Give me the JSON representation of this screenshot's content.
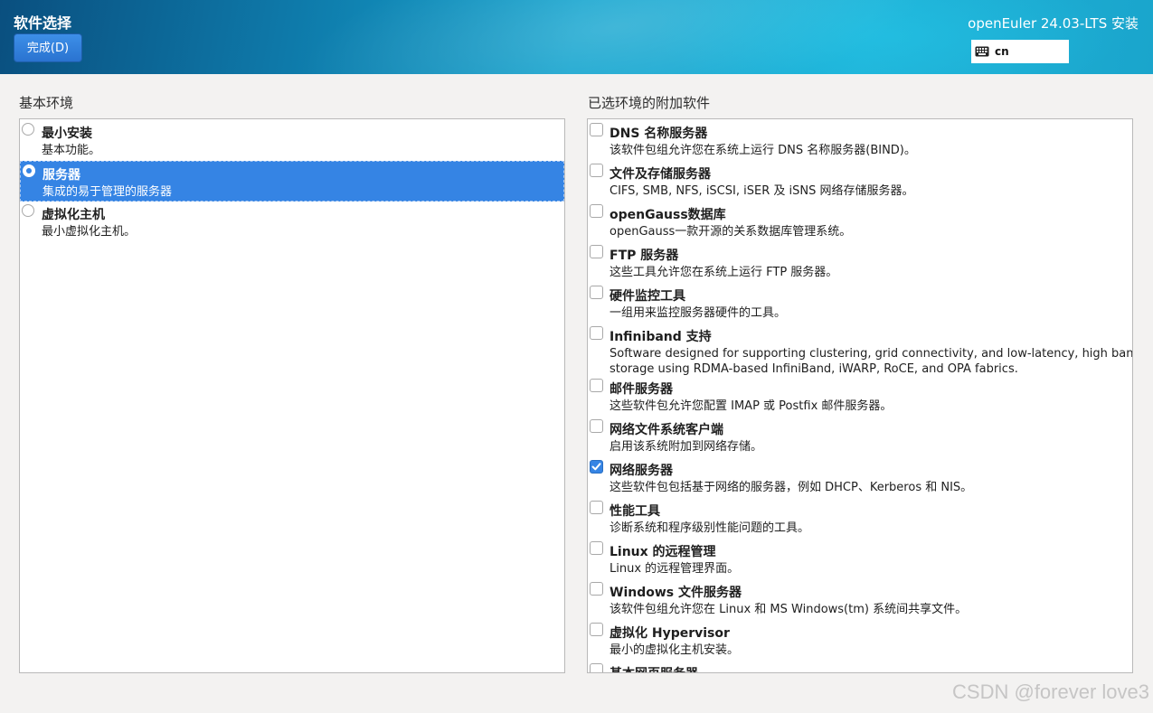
{
  "header": {
    "title": "软件选择",
    "done_label": "完成(D)",
    "product": "openEuler 24.03-LTS 安装",
    "keyboard_layout": "cn",
    "keyboard_icon": "keyboard-icon"
  },
  "base_env": {
    "label": "基本环境",
    "items": [
      {
        "name": "最小安装",
        "desc": "基本功能。",
        "selected": false
      },
      {
        "name": "服务器",
        "desc": "集成的易于管理的服务器",
        "selected": true
      },
      {
        "name": "虚拟化主机",
        "desc": "最小虚拟化主机。",
        "selected": false
      }
    ]
  },
  "addons": {
    "label": "已选环境的附加软件",
    "items": [
      {
        "name": "DNS 名称服务器",
        "desc": "该软件包组允许您在系统上运行 DNS 名称服务器(BIND)。",
        "checked": false
      },
      {
        "name": "文件及存储服务器",
        "desc": "CIFS, SMB, NFS, iSCSI, iSER 及 iSNS 网络存储服务器。",
        "checked": false
      },
      {
        "name": "openGauss数据库",
        "desc": "openGauss一款开源的关系数据库管理系统。",
        "checked": false
      },
      {
        "name": "FTP 服务器",
        "desc": "这些工具允许您在系统上运行 FTP 服务器。",
        "checked": false
      },
      {
        "name": "硬件监控工具",
        "desc": "一组用来监控服务器硬件的工具。",
        "checked": false
      },
      {
        "name": "Infiniband 支持",
        "desc": "Software designed for supporting clustering, grid connectivity, and low-latency, high bandwidth",
        "desc2": "storage using RDMA-based InfiniBand, iWARP, RoCE, and OPA fabrics.",
        "checked": false
      },
      {
        "name": "邮件服务器",
        "desc": "这些软件包允许您配置 IMAP 或 Postfix 邮件服务器。",
        "checked": false
      },
      {
        "name": "网络文件系统客户端",
        "desc": "启用该系统附加到网络存储。",
        "checked": false
      },
      {
        "name": "网络服务器",
        "desc": "这些软件包包括基于网络的服务器，例如 DHCP、Kerberos 和 NIS。",
        "checked": true
      },
      {
        "name": "性能工具",
        "desc": "诊断系统和程序级别性能问题的工具。",
        "checked": false
      },
      {
        "name": "Linux 的远程管理",
        "desc": "Linux 的远程管理界面。",
        "checked": false
      },
      {
        "name": "Windows 文件服务器",
        "desc": "该软件包组允许您在 Linux 和 MS Windows(tm) 系统间共享文件。",
        "checked": false
      },
      {
        "name": "虚拟化 Hypervisor",
        "desc": "最小的虚拟化主机安装。",
        "checked": false
      },
      {
        "name": "基本网页服务器",
        "desc": "",
        "checked": false
      }
    ]
  },
  "watermark": "CSDN @forever love3"
}
